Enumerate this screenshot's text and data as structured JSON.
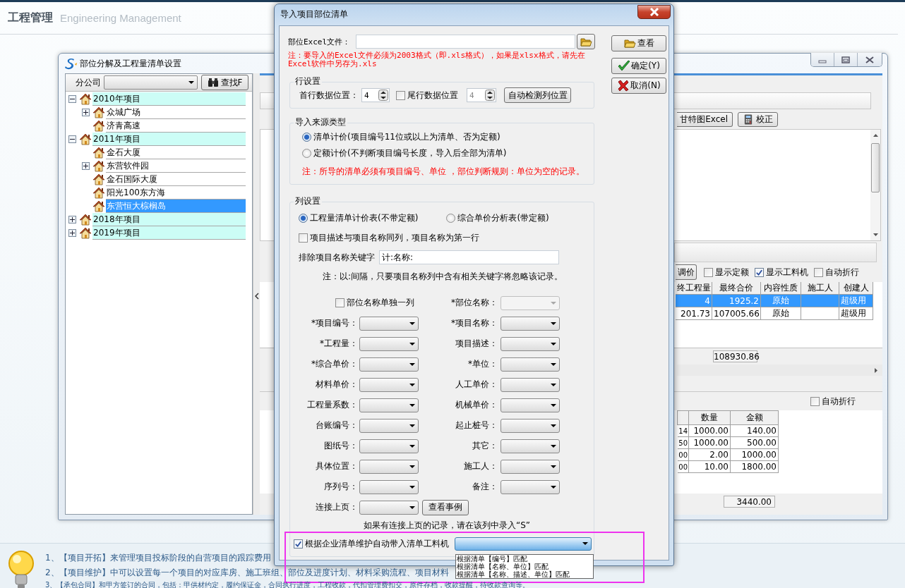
{
  "app": {
    "title": "工程管理",
    "subtitle": "Engineering Management"
  },
  "main_window": {
    "title": "部位分解及工程量清单设置",
    "branch_label": "分公司",
    "find_button": "查找F",
    "tree": [
      {
        "label": "2010年项目",
        "expanded": true,
        "selected": false,
        "children": [
          {
            "label": "众城广场",
            "expanded": false,
            "selected": false
          },
          {
            "label": "济青高速",
            "selected": false
          }
        ]
      },
      {
        "label": "2011年项目",
        "expanded": true,
        "selected": false,
        "children": [
          {
            "label": "金石大厦",
            "selected": false
          },
          {
            "label": "东营软件园",
            "expanded": false,
            "selected": false
          },
          {
            "label": "金石国际大厦",
            "selected": false
          },
          {
            "label": "阳光100东方海",
            "selected": false
          },
          {
            "label": "东营恒大棕榈岛",
            "selected": true
          }
        ]
      },
      {
        "label": "2018年项目",
        "expanded": false,
        "selected": false
      },
      {
        "label": "2019年项目",
        "expanded": false,
        "selected": false
      }
    ],
    "toolbar_buttons": [
      {
        "label": "甘特图Excel",
        "kind": "text"
      },
      {
        "label": "校正",
        "kind": "calculator"
      }
    ],
    "adjust_button": "调价",
    "options": [
      {
        "label": "显示定额",
        "checked": false
      },
      {
        "label": "显示工料机",
        "checked": true
      },
      {
        "label": "自动折行",
        "checked": false
      }
    ],
    "detail_table": {
      "columns": [
        "终工程量",
        "最终合价",
        "内容性质",
        "施工人",
        "创建人"
      ],
      "rows": [
        {
          "cells": [
            "4",
            "1925.2",
            "原始",
            "",
            "超级用"
          ],
          "selected": true
        },
        {
          "cells": [
            "201.73",
            "107005.66",
            "原始",
            "",
            "超级用"
          ],
          "selected": false
        }
      ],
      "total": "108930.86"
    },
    "materials": {
      "option": {
        "label": "自动折行",
        "checked": false
      },
      "columns": [
        "",
        "数量",
        "金额"
      ],
      "rows": [
        [
          "14",
          "1000.00",
          "140.00"
        ],
        [
          "50",
          "1000.00",
          "500.00"
        ],
        [
          "00",
          "2.00",
          "1000.00"
        ],
        [
          "00",
          "10.00",
          "1800.00"
        ]
      ],
      "total": "3440.00"
    }
  },
  "dialog": {
    "title": "导入项目部位清单",
    "file_label": "部位Excel文件：",
    "buttons": [
      {
        "label": "查看",
        "kind": "view"
      },
      {
        "label": "确定(Y)",
        "kind": "ok"
      },
      {
        "label": "取消(N)",
        "kind": "cancel"
      }
    ],
    "file_note": "注：要导入的Excel文件必须为2003格式（即.xls格式），如果是xlsx格式，请先在Excel软件中另存为.xls",
    "row_settings": {
      "title": "行设置",
      "first_row_label": "首行数据位置：",
      "first_row_value": "4",
      "last_row": {
        "label": "尾行数据位置",
        "checked": false
      },
      "last_row_value": "4",
      "detect_button": "自动检测列位置"
    },
    "source_type": {
      "title": "导入来源类型",
      "options": [
        {
          "label": "清单计价(项目编号11位或以上为清单、否为定额)",
          "selected": true
        },
        {
          "label": "定额计价(不判断项目编号长度，导入后全部为清单)",
          "selected": false
        }
      ],
      "note": "注：所导的清单必须有项目编号、单位 ，部位判断规则：单位为空的记录。"
    },
    "column_settings": {
      "title": "列设置",
      "table_types": [
        {
          "label": "工程量清单计价表(不带定额)",
          "selected": true
        },
        {
          "label": "综合单价分析表(带定额)",
          "selected": false
        }
      ],
      "same_column": {
        "label": "项目描述与项目名称同列，项目名称为第一行",
        "checked": false
      },
      "exclude_label": "排除项目名称关键字",
      "exclude_value": "计:名称:",
      "exclude_note": "注：以:间隔，只要项目名称列中含有相关关键字将忽略该记录。",
      "separate_column": {
        "label": "部位名称单独一列",
        "checked": false
      },
      "fields": [
        {
          "label": "*部位名称：",
          "disabled": true
        },
        {
          "label": "*项目编号：",
          "disabled": false
        },
        {
          "label": "*项目名称：",
          "disabled": false
        },
        {
          "label": "*工程量：",
          "disabled": false
        },
        {
          "label": "项目描述：",
          "disabled": false
        },
        {
          "label": "*综合单价：",
          "disabled": false
        },
        {
          "label": "*单位：",
          "disabled": false
        },
        {
          "label": "材料单价：",
          "disabled": false
        },
        {
          "label": "人工单价：",
          "disabled": false
        },
        {
          "label": "工程量系数：",
          "disabled": false
        },
        {
          "label": "机械单价：",
          "disabled": false
        },
        {
          "label": "台账编号：",
          "disabled": false
        },
        {
          "label": "起止桩号：",
          "disabled": false
        },
        {
          "label": "图纸号：",
          "disabled": false
        },
        {
          "label": "其它：",
          "disabled": false
        },
        {
          "label": "具体位置：",
          "disabled": false
        },
        {
          "label": "施工人：",
          "disabled": false
        },
        {
          "label": "序列号：",
          "disabled": false
        },
        {
          "label": "备注：",
          "disabled": false
        }
      ],
      "link_label": "连接上页：",
      "example_button": "查看事例",
      "link_note": "如果有连接上页的记录，请在该列中录入“S”",
      "auto_fill": {
        "label": "根据企业清单维护自动带入清单工料机",
        "checked": true,
        "expanded": true,
        "options": [
          "根据清单【编号】匹配",
          "根据清单【名称、单位】匹配",
          "根据清单【名称、描述、单位】匹配"
        ]
      }
    }
  },
  "tips": [
    "1、【项目开拓】来管理项目投标阶段的自营项目的跟踪费用",
    "2、【项目维护】中可以设置每一个项目的对应库房、施工班组、部位及进度计划、材料采购流程、项目材料",
    "3、【承包合同】和甲方签订的合同，包括：甲供材约定，履约保证金，合同执行进度，工程收款，代扣管理费扣交，原件存档，收款提醒，待收款查询等。"
  ]
}
